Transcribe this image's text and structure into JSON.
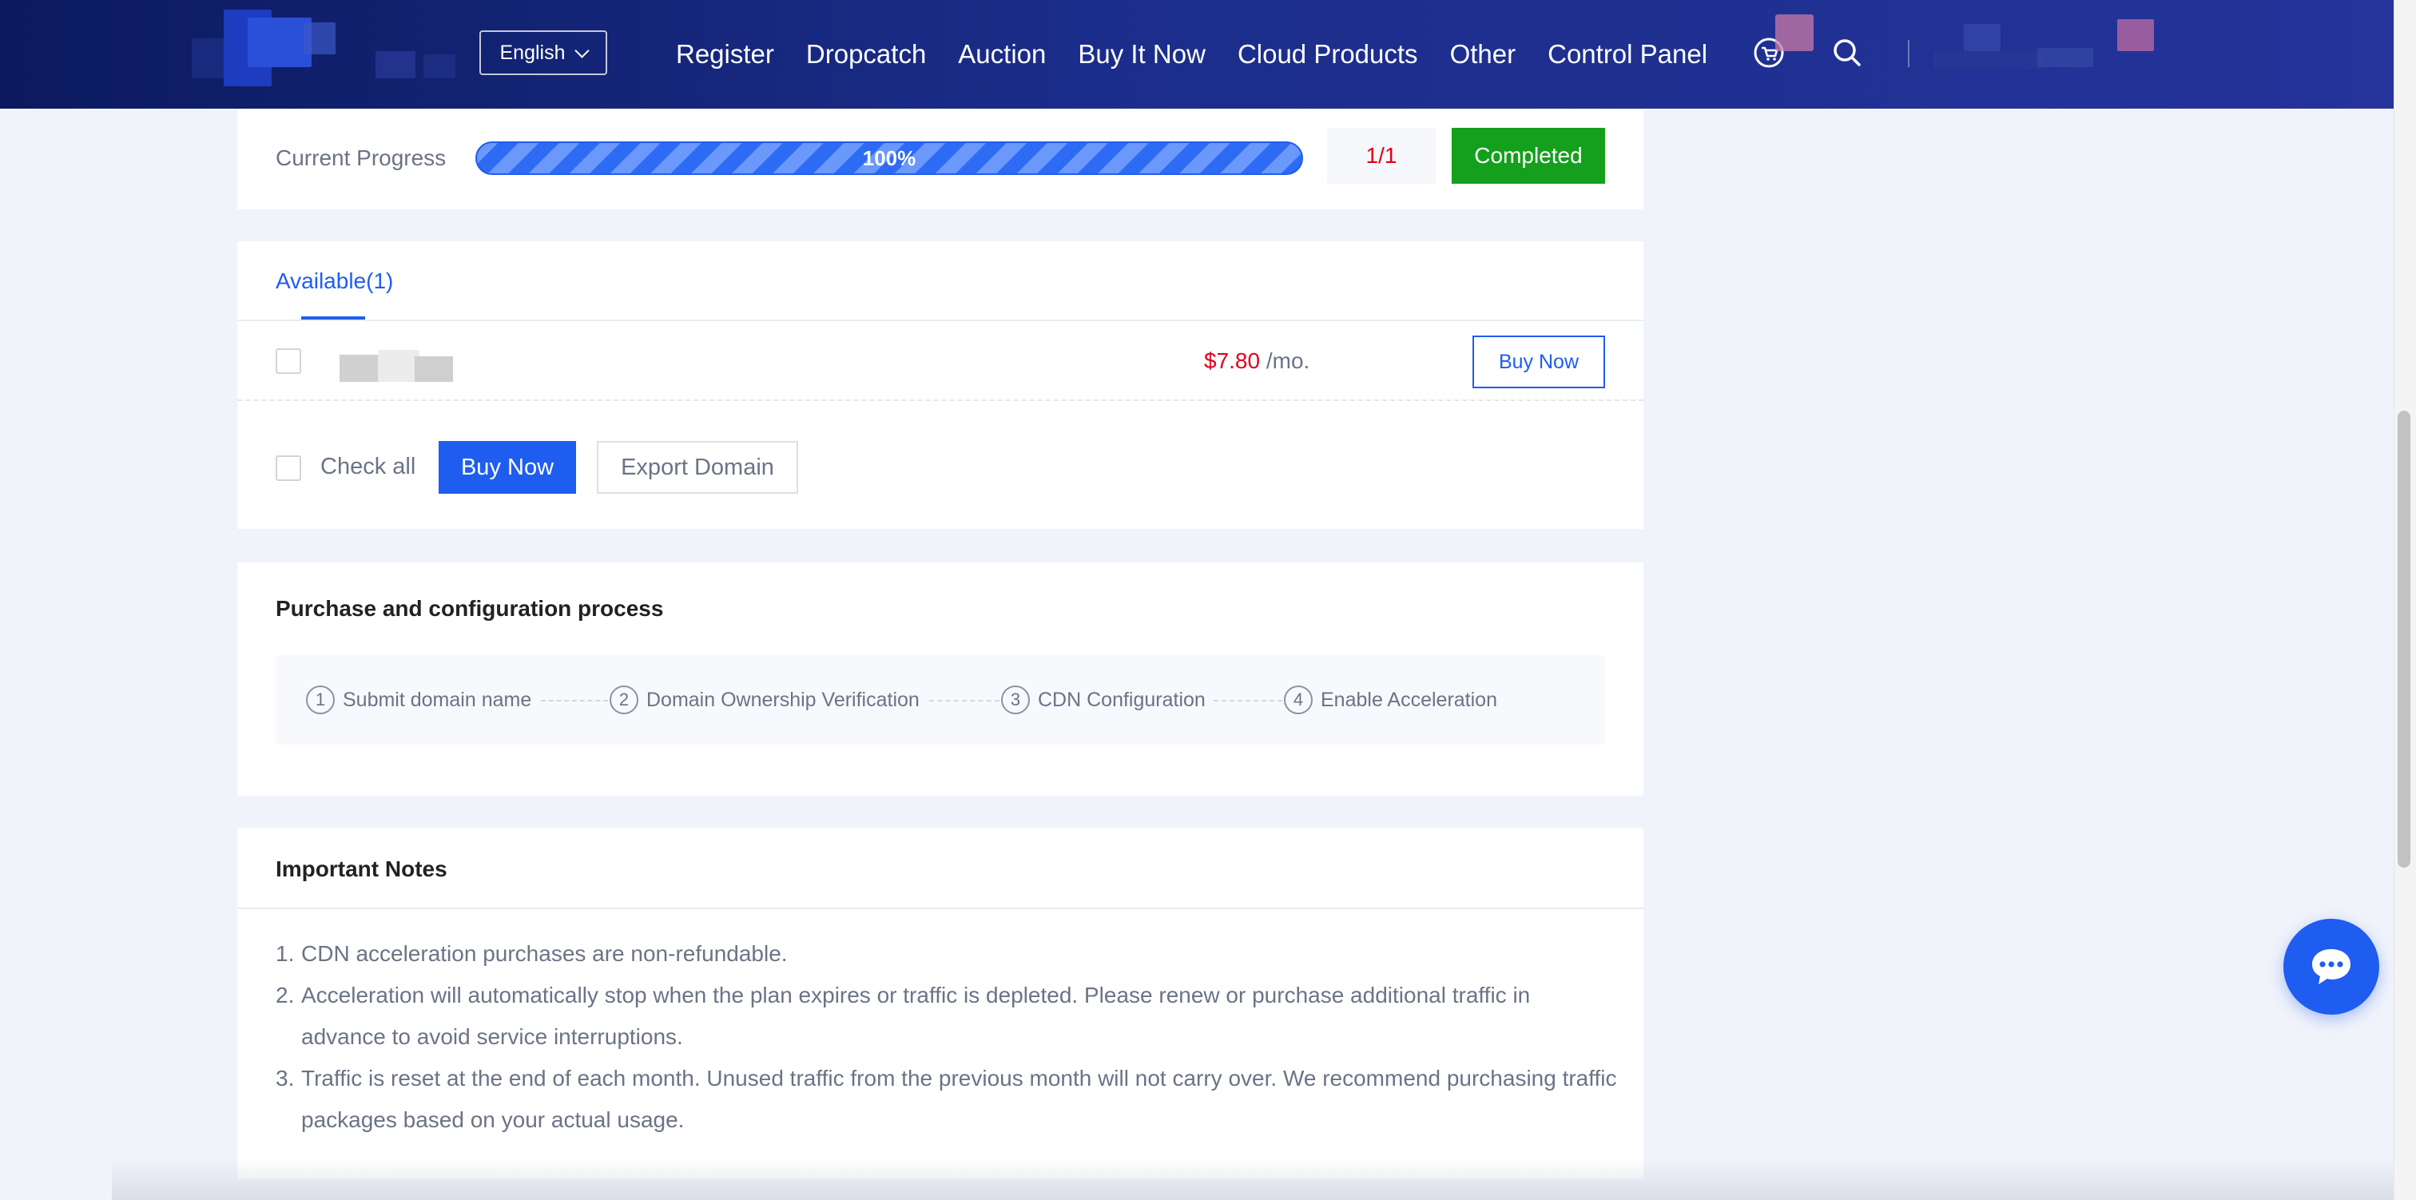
{
  "header": {
    "language": "English",
    "nav": [
      "Register",
      "Dropcatch",
      "Auction",
      "Buy It Now",
      "Cloud Products",
      "Other",
      "Control Panel"
    ]
  },
  "progress": {
    "label": "Current Progress",
    "percent_text": "100%",
    "percent_value": 100,
    "count": "1/1",
    "status": "Completed"
  },
  "available": {
    "tab_label": "Available(1)",
    "rows": [
      {
        "price": "$7.80",
        "unit": "/mo.",
        "buy_label": "Buy Now"
      }
    ],
    "check_all": "Check all",
    "buy_now": "Buy Now",
    "export": "Export Domain"
  },
  "process": {
    "title": "Purchase and configuration process",
    "steps": [
      {
        "num": "1",
        "label": "Submit domain name"
      },
      {
        "num": "2",
        "label": "Domain Ownership Verification"
      },
      {
        "num": "3",
        "label": "CDN Configuration"
      },
      {
        "num": "4",
        "label": "Enable Acceleration"
      }
    ]
  },
  "notes": {
    "title": "Important Notes",
    "items": [
      {
        "num": "1.",
        "text": "CDN acceleration purchases are non-refundable."
      },
      {
        "num": "2.",
        "text": "Acceleration will automatically stop when the plan expires or traffic is depleted. Please renew or purchase additional traffic in advance to avoid service interruptions."
      },
      {
        "num": "3.",
        "text": "Traffic is reset at the end of each month. Unused traffic from the previous month will not carry over. We recommend purchasing traffic packages based on your actual usage."
      }
    ]
  },
  "colors": {
    "accent": "#1f5df0",
    "price": "#e0001b",
    "success": "#14a01c",
    "nav_bg": "#1b2d8a"
  },
  "icons": [
    "cart-icon",
    "search-icon",
    "chat-icon",
    "chevron-down-icon"
  ]
}
